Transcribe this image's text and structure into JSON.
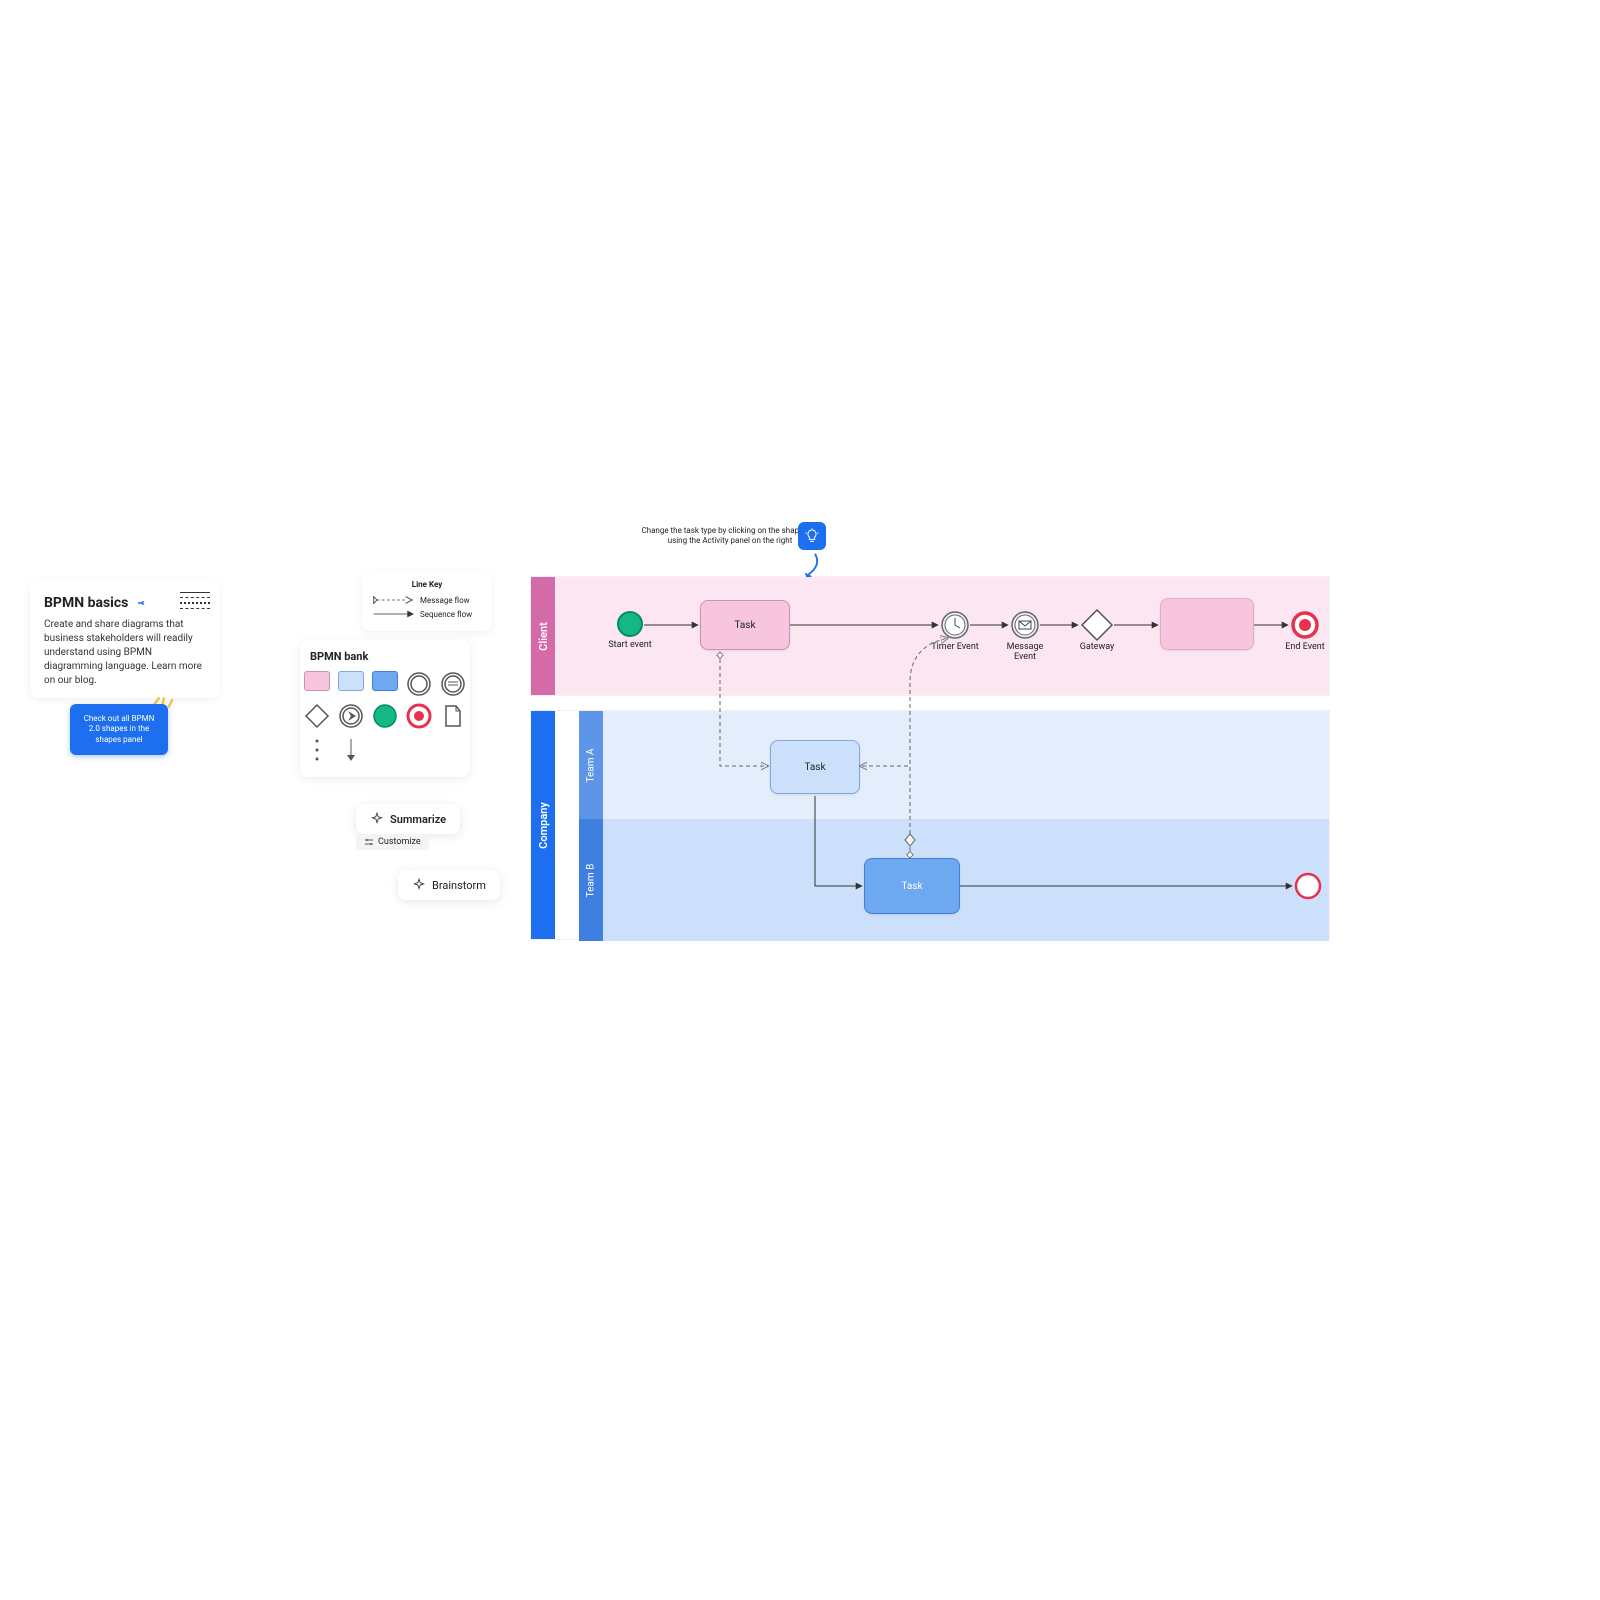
{
  "info": {
    "title": "BPMN basics",
    "body": "Create and share diagrams that business stakeholders will readily understand using BPMN diagramming language. Learn more on our blog."
  },
  "cta": {
    "label": "Check out all BPMN 2.0 shapes in the shapes panel"
  },
  "key": {
    "title": "Line Key",
    "message_flow": "Message flow",
    "sequence_flow": "Sequence flow"
  },
  "bank": {
    "title": "BPMN bank",
    "palette": [
      "#f7c6de",
      "#cde0fb",
      "#6ea8f0"
    ]
  },
  "actions": {
    "summarize": "Summarize",
    "customize": "Customize",
    "brainstorm": "Brainstorm"
  },
  "hint": "Change the task type by clicking on the shape and using the Activity panel on the right",
  "pools": {
    "client": {
      "label": "Client"
    },
    "company": {
      "label": "Company",
      "lanes": {
        "a": "Team A",
        "b": "Team B"
      }
    }
  },
  "nodes": {
    "start_event": "Start event",
    "task1": "Task",
    "timer_event": "Timer Event",
    "message_event": "Message Event",
    "gateway": "Gateway",
    "end_event": "End Event",
    "task_a": "Task",
    "task_b": "Task"
  }
}
